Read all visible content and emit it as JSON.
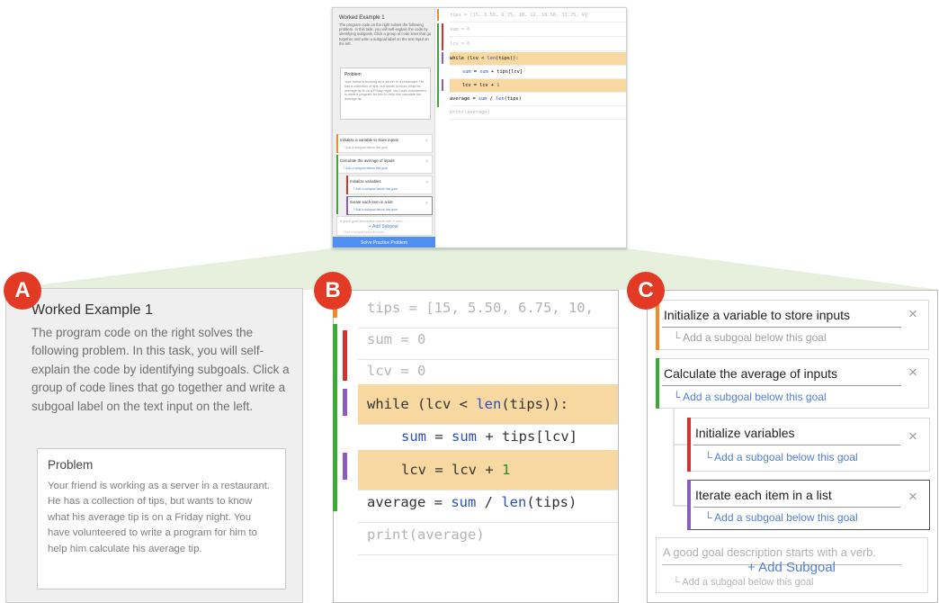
{
  "badges": {
    "a": "A",
    "b": "B",
    "c": "C"
  },
  "colors": {
    "orange": "#f08a24",
    "red": "#d0342c",
    "green": "#3aaa35",
    "purple": "#8a5cc0",
    "highlight": "#f7d8a0",
    "link": "#4f7fd9",
    "solve_button": "#4f8ff0",
    "badge": "#e23a25"
  },
  "left_panel": {
    "title": "Worked Example 1",
    "description": "The program code on the right solves the following problem. In this task, you will self-explain the code by identifying subgoals. Click a group of code lines that go together and write a subgoal label on the text input on the left.",
    "problem_title": "Problem",
    "problem_text": "Your friend is working as a server in a restaurant. He has a collection of tips, but wants to know what his average tip is on a Friday night. You have volunteered to write a program for him to help him calculate his average tip."
  },
  "code_panel": {
    "thumb_line1": "tips = [15, 5.50, 6.75, 10, 12, 18.50, 11.75, 9]",
    "line1": "tips = [15, 5.50, 6.75, 10,",
    "line2": "sum = 0",
    "line3": "lcv = 0",
    "line4_kw": "while (lcv < ",
    "line4_fn": "len",
    "line4_end": "(tips)):",
    "line5_a": "sum",
    "line5_b": " = ",
    "line5_c": "sum",
    "line5_d": " + tips[lcv]",
    "line6_a": "lcv = lcv + ",
    "line6_num": "1",
    "line7_a": "average = ",
    "line7_b": "sum",
    "line7_c": " / ",
    "line7_d": "len",
    "line7_e": "(tips)",
    "line8": "print(average)"
  },
  "subgoals": {
    "g1": "Initialize a variable to store inputs",
    "g2": "Calculate the average of inputs",
    "g3": "Initialize variables",
    "g4": "Iterate each item in a list",
    "add_below": "└ Add a subgoal below this goal",
    "close": "×",
    "new_placeholder": "A good goal description starts with a verb.",
    "add_subgoal": "+ Add Subgoal"
  },
  "thumbnail": {
    "solve_button": "Solve Practice Problem"
  }
}
